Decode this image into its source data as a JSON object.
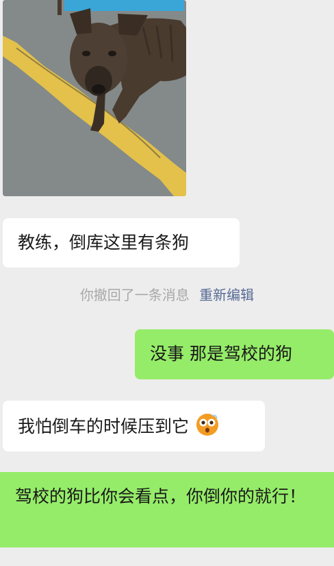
{
  "messages": [
    {
      "id": "m1",
      "side": "incoming",
      "type": "image",
      "description_icon": "dog-photo"
    },
    {
      "id": "m2",
      "side": "incoming",
      "text": "教练，倒库这里有条狗"
    },
    {
      "id": "m3",
      "side": "outgoing",
      "text": "没事 那是驾校的狗"
    },
    {
      "id": "m4",
      "side": "incoming",
      "text": "我怕倒车的时候压到它",
      "emoji": "dizzy-face-emoji"
    },
    {
      "id": "m5",
      "side": "outgoing",
      "text": "驾校的狗比你会看点，你倒你的就行！"
    }
  ],
  "system_notice": {
    "text": "你撤回了一条消息",
    "action": "重新编辑"
  },
  "colors": {
    "background": "#ededed",
    "incoming_bubble": "#ffffff",
    "outgoing_bubble": "#95ec69",
    "notice_text": "#a8a8a8",
    "link": "#576b95"
  }
}
